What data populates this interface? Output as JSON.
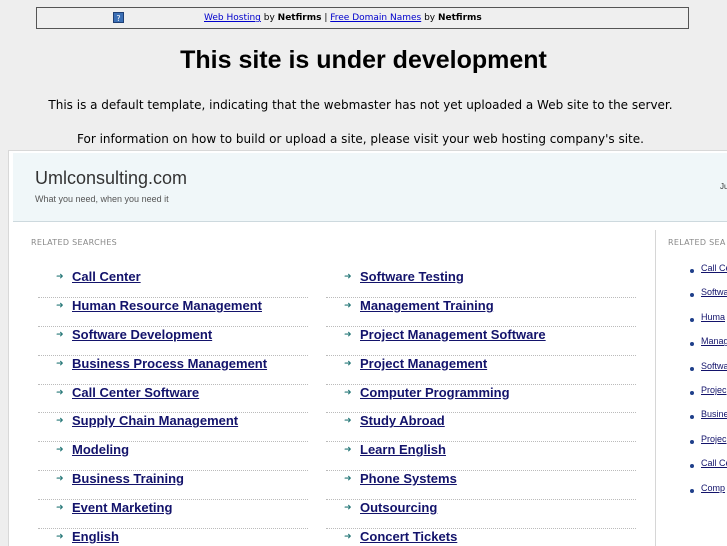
{
  "topbar": {
    "icon": "question-icon",
    "link1": "Web Hosting",
    "by1": " by ",
    "brand1": "Netfirms",
    "sep": " | ",
    "link2": "Free Domain Names",
    "by2": " by ",
    "brand2": "Netfirms"
  },
  "headline": "This site is under development",
  "message1": "This is a default template, indicating that the webmaster has not yet uploaded a Web site to the server.",
  "message2": "For information on how to build or upload a site, please visit your web hosting company's site.",
  "site": {
    "title": "Umlconsulting.com",
    "tagline": "What you need, when you need it",
    "right_text": "Ju"
  },
  "related": {
    "label": "RELATED SEARCHES",
    "left": [
      "Call Center",
      "Human Resource Management",
      "Software Development",
      "Business Process Management",
      "Call Center Software",
      "Supply Chain Management",
      "Modeling",
      "Business Training",
      "Event Marketing",
      "English"
    ],
    "right": [
      "Software Testing",
      "Management Training",
      "Project Management Software",
      "Project Management",
      "Computer Programming",
      "Study Abroad",
      "Learn English",
      "Phone Systems",
      "Outsourcing",
      "Concert Tickets"
    ]
  },
  "sidebar": {
    "label": "RELATED SEA",
    "items": [
      "Call Ce",
      "Softwa",
      "Huma",
      "Manag",
      "Softwa",
      "Projec",
      "Busine",
      "Projec",
      "Call Ce",
      "Comp"
    ]
  }
}
